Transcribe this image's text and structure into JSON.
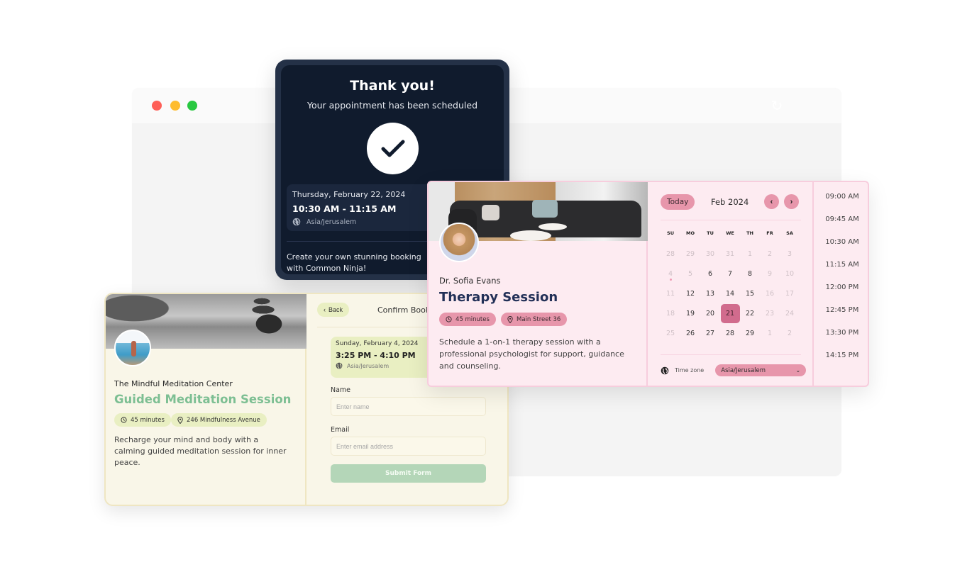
{
  "browser": {
    "window_controls": [
      "close",
      "minimize",
      "maximize"
    ],
    "reload_icon": "reload-icon"
  },
  "confirmation": {
    "title": "Thank you!",
    "subtitle": "Your appointment has been scheduled",
    "icon": "check-icon",
    "date": "Thursday, February 22, 2024",
    "time": "10:30 AM - 11:15 AM",
    "timezone": "Asia/Jerusalem",
    "cta": "Create your own stunning booking with Common Ninja!"
  },
  "meditation": {
    "organization": "The Mindful Meditation Center",
    "title": "Guided Meditation Session",
    "duration": "45 minutes",
    "location": "246 Mindfulness Avenue",
    "description": "Recharge your mind and body with a calming guided meditation session for inner peace.",
    "back_label": "Back",
    "confirm_title": "Confirm Booking",
    "summary": {
      "date": "Sunday, February 4, 2024",
      "time": "3:25 PM - 4:10 PM",
      "timezone": "Asia/Jerusalem"
    },
    "form": {
      "name_label": "Name",
      "name_placeholder": "Enter name",
      "email_label": "Email",
      "email_placeholder": "Enter email address",
      "submit_label": "Submit Form"
    },
    "colors": {
      "accent": "#7dbf93",
      "chip": "#e9efc2",
      "background": "#f9f6e8"
    }
  },
  "therapy": {
    "owner": "Dr. Sofia Evans",
    "title": "Therapy Session",
    "duration": "45 minutes",
    "location": "Main Street 36",
    "description": "Schedule a 1-on-1 therapy session with a professional psychologist for support, guidance and counseling.",
    "calendar": {
      "today_label": "Today",
      "month_label": "Feb 2024",
      "weekdays": [
        "SU",
        "MO",
        "TU",
        "WE",
        "TH",
        "FR",
        "SA"
      ],
      "days": [
        {
          "d": "28",
          "muted": true
        },
        {
          "d": "29",
          "muted": true
        },
        {
          "d": "30",
          "muted": true
        },
        {
          "d": "31",
          "muted": true
        },
        {
          "d": "1",
          "muted": true
        },
        {
          "d": "2",
          "muted": true
        },
        {
          "d": "3",
          "muted": true
        },
        {
          "d": "4",
          "muted": true,
          "today": true
        },
        {
          "d": "5",
          "muted": true
        },
        {
          "d": "6"
        },
        {
          "d": "7"
        },
        {
          "d": "8"
        },
        {
          "d": "9",
          "muted": true
        },
        {
          "d": "10",
          "muted": true
        },
        {
          "d": "11",
          "muted": true
        },
        {
          "d": "12"
        },
        {
          "d": "13"
        },
        {
          "d": "14"
        },
        {
          "d": "15"
        },
        {
          "d": "16",
          "muted": true
        },
        {
          "d": "17",
          "muted": true
        },
        {
          "d": "18",
          "muted": true
        },
        {
          "d": "19"
        },
        {
          "d": "20"
        },
        {
          "d": "21",
          "selected": true
        },
        {
          "d": "22"
        },
        {
          "d": "23",
          "muted": true
        },
        {
          "d": "24",
          "muted": true
        },
        {
          "d": "25",
          "muted": true
        },
        {
          "d": "26"
        },
        {
          "d": "27"
        },
        {
          "d": "28"
        },
        {
          "d": "29"
        },
        {
          "d": "1",
          "muted": true
        },
        {
          "d": "2",
          "muted": true
        }
      ],
      "timezone_label": "Time zone",
      "timezone_value": "Asia/Jerusalem"
    },
    "times": [
      "09:00 AM",
      "09:45 AM",
      "10:30 AM",
      "11:15 AM",
      "12:00 PM",
      "12:45 PM",
      "13:30 PM",
      "14:15 PM"
    ],
    "colors": {
      "accent": "#e796ab",
      "selected": "#d16b8d",
      "background": "#fdebf1",
      "title": "#223057"
    }
  }
}
